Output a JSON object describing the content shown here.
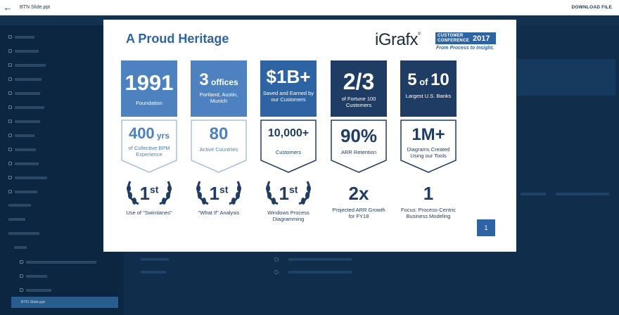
{
  "topbar": {
    "title": "BTN Slide.ppt",
    "download": "DOWNLOAD FILE"
  },
  "sidebar": [
    {
      "label": "BTN Slide.ppt",
      "active": true
    }
  ],
  "slide": {
    "title": "A Proud Heritage",
    "logo": {
      "brand": "iGrafx",
      "registered": "®",
      "conference": "CUSTOMER CONFERENCE",
      "year": "2017",
      "tagline": "From Process to Insight."
    },
    "columns": [
      {
        "top_big": "1991",
        "top_small": "Foundation",
        "mid_big": "400",
        "mid_unit": " yrs",
        "mid_small": "of Collective BPM Experience",
        "rank_big": "1",
        "rank_sup": "st",
        "rank_small": "Use of \"Swimlanes\""
      },
      {
        "top_big": "3",
        "top_unit": " offices",
        "top_small": "Portland, Austin, Munich",
        "mid_big": "80",
        "mid_small": "Active Countries",
        "rank_big": "1",
        "rank_sup": "st",
        "rank_small": "\"What If\" Analysis"
      },
      {
        "top_big": "$1B+",
        "top_small": "Saved and Earned by our Customers",
        "mid_big": "10,000+",
        "mid_small": "Customers",
        "rank_big": "1",
        "rank_sup": "st",
        "rank_small": "Windows Process Diagramming"
      },
      {
        "top_big": "2/3",
        "top_small": "of Fortune 100 Customers",
        "mid_big": "90%",
        "mid_small": "ARR Retention",
        "rank_big": "2x",
        "rank_small": "Projected ARR Growth for FY18"
      },
      {
        "top_big": "5",
        "top_of": " of ",
        "top_big2": "10",
        "top_small": "Largest U.S. Banks",
        "mid_big": "1M+",
        "mid_small": "Diagrams Created Using our Tools",
        "rank_big": "1",
        "rank_small": "Focus: Process-Centric Business Modeling"
      }
    ],
    "page_number": "1"
  },
  "colors": {
    "heading": "#2e64a3",
    "box_blue": "#2e64a3",
    "box_light": "#4d81bf",
    "box_dark": "#1f3d64",
    "background": "#0f2a47"
  }
}
